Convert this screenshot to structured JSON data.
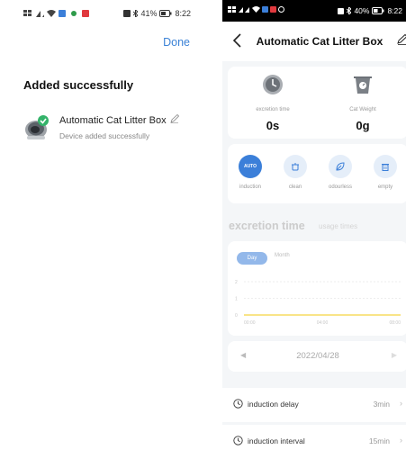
{
  "left": {
    "status": {
      "battery": "41%",
      "time": "8:22"
    },
    "done_label": "Done",
    "heading": "Added successfully",
    "device": {
      "name": "Automatic Cat Litter Box",
      "status": "Device added successfully"
    }
  },
  "right": {
    "status": {
      "battery": "40%",
      "time": "8:22"
    },
    "title": "Automatic Cat Litter Box",
    "stats": [
      {
        "label": "excretion time",
        "value": "0s",
        "icon": "clock-icon"
      },
      {
        "label": "Cat Weight",
        "value": "0g",
        "icon": "scale-icon"
      }
    ],
    "actions": [
      {
        "label": "induction",
        "icon": "auto-icon",
        "badge": "AUTO",
        "active": true
      },
      {
        "label": "clean",
        "icon": "clean-icon",
        "active": false
      },
      {
        "label": "odourless",
        "icon": "leaf-icon",
        "active": false
      },
      {
        "label": "empty",
        "icon": "trash-icon",
        "active": false
      }
    ],
    "tabs": {
      "primary": "excretion time",
      "secondary": "usage times"
    },
    "chart_data": {
      "type": "line",
      "segments": [
        "Day",
        "Month"
      ],
      "selected_segment": "Day",
      "x": [
        "00:00",
        "04:00",
        "08:00"
      ],
      "y_ticks": [
        "2",
        "1",
        "0"
      ],
      "series": [
        {
          "values": [
            0,
            0,
            0
          ]
        }
      ],
      "ylim": [
        0,
        2
      ],
      "line_color": "#f5d442"
    },
    "date": "2022/04/28",
    "settings": [
      {
        "label": "induction delay",
        "value": "3min"
      },
      {
        "label": "induction interval",
        "value": "15min"
      }
    ],
    "accent": "#3b7fd9"
  }
}
